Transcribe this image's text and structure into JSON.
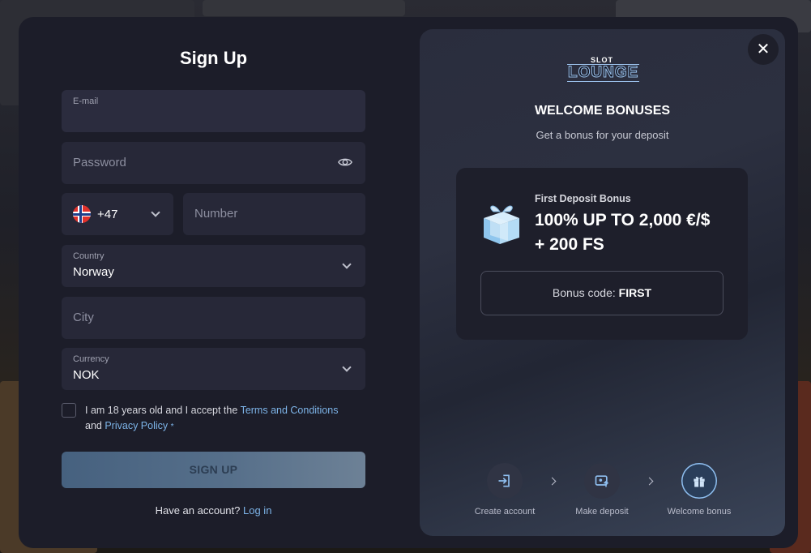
{
  "form": {
    "title": "Sign Up",
    "email": {
      "label": "E-mail",
      "value": ""
    },
    "password": {
      "placeholder": "Password"
    },
    "phone": {
      "code": "+47",
      "placeholder": "Number"
    },
    "country": {
      "label": "Country",
      "value": "Norway"
    },
    "city": {
      "placeholder": "City"
    },
    "currency": {
      "label": "Currency",
      "value": "NOK"
    },
    "terms": {
      "prefix": "I am 18 years old and I accept the",
      "terms_link": "Terms and Conditions",
      "and": "and",
      "privacy_link": "Privacy Policy",
      "required_mark": "*"
    },
    "submit_label": "SIGN UP",
    "have_account": {
      "text": "Have an account?",
      "link": "Log in"
    }
  },
  "panel": {
    "logo": {
      "top": "SLOT",
      "main": "LOUNGE"
    },
    "title": "WELCOME BONUSES",
    "subtitle": "Get a bonus for your deposit",
    "bonus": {
      "name": "First Deposit Bonus",
      "amount_line1": "100% UP TO 2,000 €/$",
      "amount_line2": "+ 200 FS",
      "code_label": "Bonus code:",
      "code": "FIRST"
    },
    "steps": [
      {
        "label": "Create account",
        "icon": "login-icon"
      },
      {
        "label": "Make deposit",
        "icon": "wallet-icon"
      },
      {
        "label": "Welcome bonus",
        "icon": "gift-icon"
      }
    ]
  },
  "colors": {
    "modal_bg": "#1c1d29",
    "field_bg": "#272838",
    "link": "#7db4e8",
    "active_step_ring": "#8fbff0"
  }
}
